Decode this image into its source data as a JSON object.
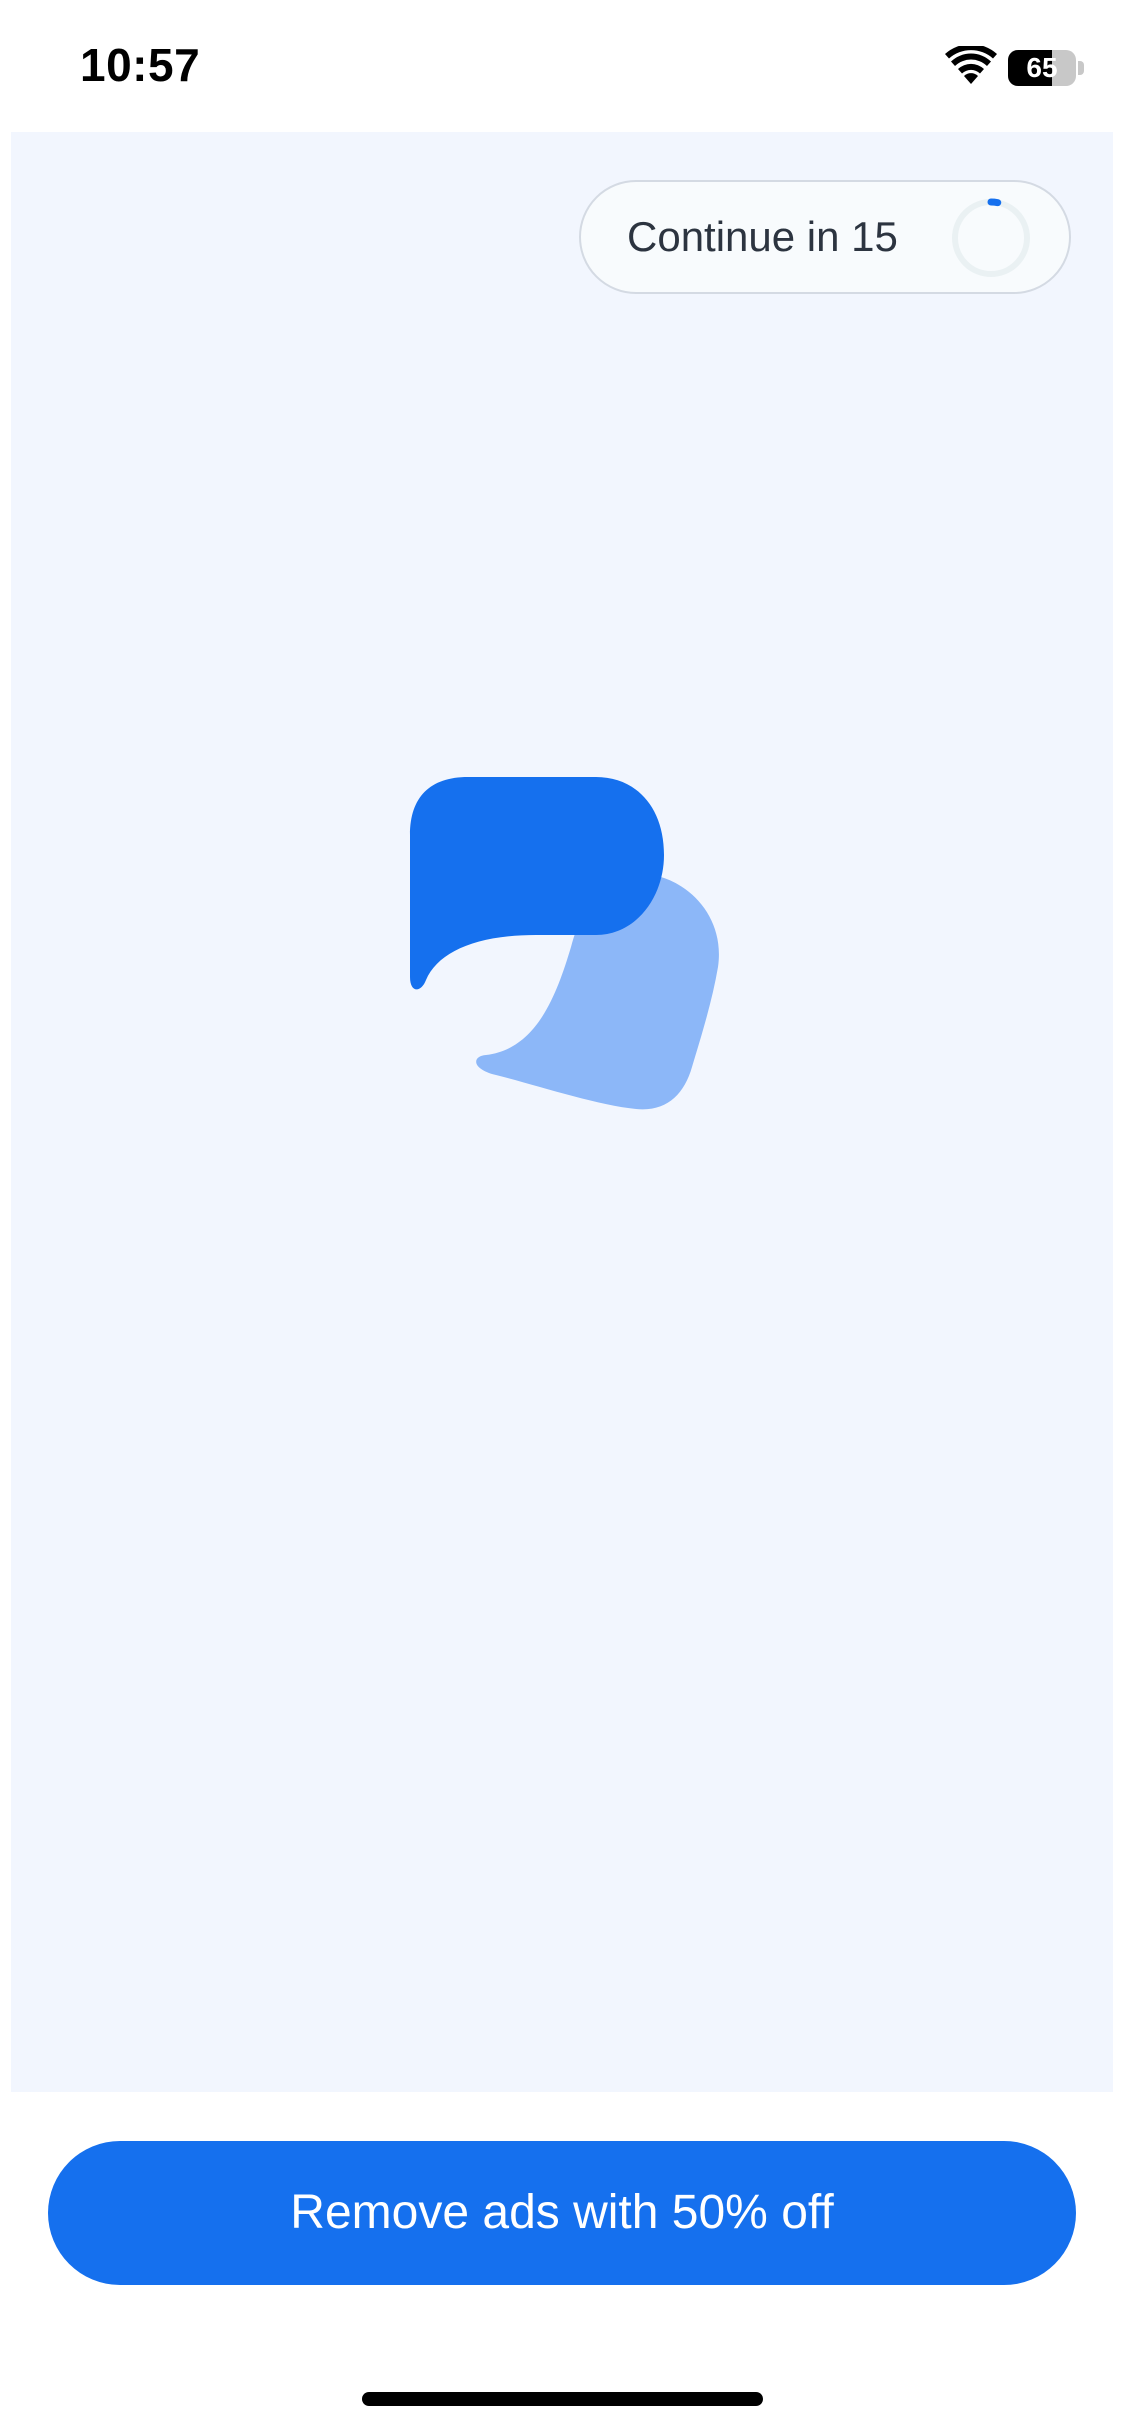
{
  "status_bar": {
    "time": "10:57",
    "battery_level": "65",
    "battery_percent": 65,
    "icons": [
      "wifi-icon",
      "battery-icon"
    ]
  },
  "ad": {
    "continue_label": "Continue in 15",
    "countdown_progress": 0.03,
    "logo": "speech-bubbles-logo-icon",
    "background_color": "#f2f6fe"
  },
  "cta": {
    "label": "Remove ads with 50% off",
    "color": "#1570ee"
  },
  "colors": {
    "accent": "#1570ee",
    "accent_light": "#8cb7f8"
  }
}
